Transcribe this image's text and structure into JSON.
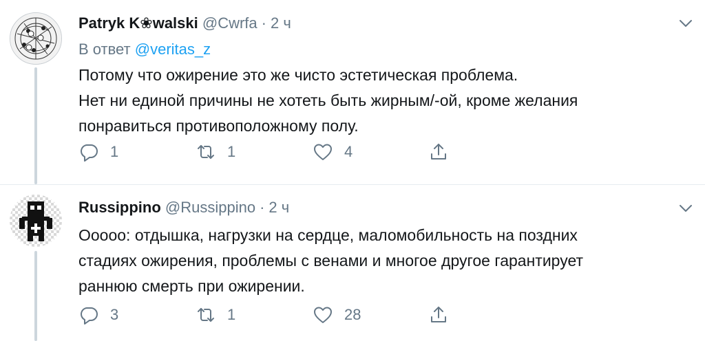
{
  "tweets": [
    {
      "display_name": "Patryk K❀walski",
      "handle": "@Cwrfa",
      "separator": "·",
      "time": "2 ч",
      "reply_prefix": "В ответ",
      "reply_to": "@veritas_z",
      "text_lines": [
        "Потому что ожирение это же чисто эстетическая проблема.",
        "Нет ни единой причины не хотеть быть жирным/-ой, кроме желания",
        "понравиться противоположному полу."
      ],
      "replies": "1",
      "retweets": "1",
      "likes": "4"
    },
    {
      "display_name": "Russippino",
      "handle": "@Russippino",
      "separator": "·",
      "time": "2 ч",
      "text_lines": [
        "Ооооо: отдышка, нагрузки на сердце, маломобильность на поздних",
        "стадиях ожирения, проблемы с венами и многое другое гарантирует",
        "раннюю смерть при ожирении."
      ],
      "replies": "3",
      "retweets": "1",
      "likes": "28"
    }
  ],
  "icons": {
    "reply": "reply-icon",
    "retweet": "retweet-icon",
    "like": "heart-icon",
    "share": "share-icon",
    "menu": "chevron-down-icon"
  },
  "colors": {
    "text": "#14171a",
    "secondary": "#657786",
    "link": "#1da1f2",
    "thread_line": "#ccd6dd",
    "divider": "#e6ecf0"
  }
}
